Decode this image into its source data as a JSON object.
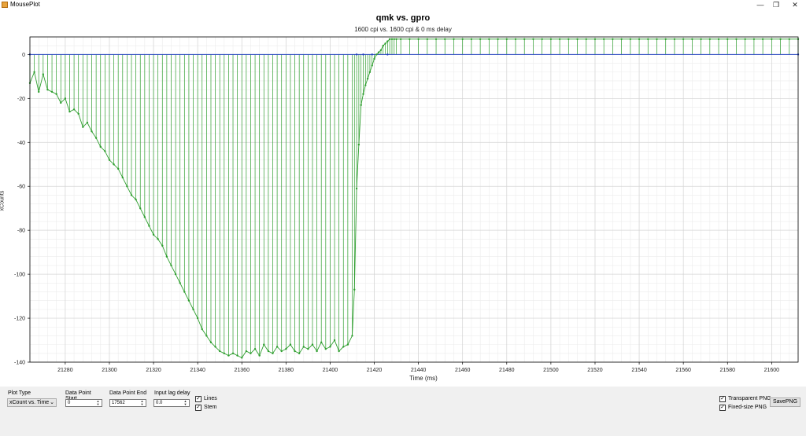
{
  "window": {
    "title": "MousePlot",
    "minimize": "—",
    "restore": "❐",
    "close": "✕"
  },
  "plot": {
    "title": "qmk vs. gpro",
    "subtitle": "1600 cpi vs. 1600 cpi & 0 ms delay"
  },
  "chart_data": {
    "type": "line",
    "title": "qmk vs. gpro",
    "subtitle": "1600 cpi vs. 1600 cpi & 0 ms delay",
    "xlabel": "Time (ms)",
    "ylabel": "xCounts",
    "xlim": [
      21264,
      21612
    ],
    "ylim": [
      -140,
      8
    ],
    "xticks": [
      21280,
      21300,
      21320,
      21340,
      21360,
      21380,
      21400,
      21420,
      21440,
      21460,
      21480,
      21500,
      21520,
      21540,
      21560,
      21580,
      21600
    ],
    "yticks": [
      0,
      -20,
      -40,
      -60,
      -80,
      -100,
      -120,
      -140
    ],
    "grid": true,
    "stem": true,
    "series": [
      {
        "color": "#2e9e2e",
        "x": [
          21264,
          21266,
          21268,
          21270,
          21272,
          21274,
          21276,
          21278,
          21280,
          21282,
          21284,
          21286,
          21288,
          21290,
          21292,
          21294,
          21296,
          21298,
          21300,
          21302,
          21304,
          21306,
          21308,
          21310,
          21312,
          21314,
          21316,
          21318,
          21320,
          21322,
          21324,
          21326,
          21328,
          21330,
          21332,
          21334,
          21336,
          21338,
          21340,
          21342,
          21344,
          21346,
          21348,
          21350,
          21352,
          21354,
          21356,
          21358,
          21360,
          21362,
          21364,
          21366,
          21368,
          21370,
          21372,
          21374,
          21376,
          21378,
          21380,
          21382,
          21384,
          21386,
          21388,
          21390,
          21392,
          21394,
          21396,
          21398,
          21400,
          21402,
          21404,
          21406,
          21408,
          21410,
          21411,
          21412,
          21413,
          21414,
          21415,
          21416,
          21417,
          21418,
          21419,
          21420,
          21421,
          21422,
          21423,
          21424,
          21425,
          21426,
          21427,
          21428,
          21429,
          21430,
          21432,
          21436,
          21440,
          21444,
          21448,
          21452,
          21456,
          21460,
          21464,
          21468,
          21472,
          21476,
          21480,
          21484,
          21488,
          21492,
          21496,
          21500,
          21504,
          21508,
          21512,
          21516,
          21520,
          21524,
          21528,
          21532,
          21536,
          21540,
          21544,
          21548,
          21552,
          21556,
          21560,
          21564,
          21568,
          21572,
          21576,
          21580,
          21584,
          21588,
          21592,
          21596,
          21600,
          21604,
          21608,
          21612
        ],
        "y": [
          -13,
          -8,
          -17,
          -9,
          -16,
          -17,
          -18,
          -22,
          -20,
          -26,
          -25,
          -27,
          -33,
          -31,
          -35,
          -38,
          -42,
          -44,
          -48,
          -50,
          -52,
          -56,
          -60,
          -64,
          -66,
          -70,
          -74,
          -78,
          -82,
          -84,
          -87,
          -92,
          -96,
          -100,
          -104,
          -108,
          -112,
          -116,
          -120,
          -125,
          -128,
          -131,
          -133,
          -135,
          -136,
          -137,
          -136,
          -137,
          -138,
          -135,
          -136,
          -134,
          -137,
          -132,
          -135,
          -136,
          -133,
          -135,
          -134,
          -132,
          -135,
          -136,
          -133,
          -134,
          -132,
          -135,
          -131,
          -134,
          -133,
          -130,
          -135,
          -133,
          -132,
          -128,
          -107,
          -61,
          -41,
          -23,
          -18,
          -14,
          -11,
          -8,
          -5,
          -2,
          0,
          1,
          2,
          4,
          5,
          6,
          7,
          7,
          7,
          7,
          7,
          7,
          7,
          7,
          7,
          7,
          7,
          7,
          7,
          7,
          7,
          7,
          7,
          7,
          7,
          7,
          7,
          7,
          7,
          7,
          7,
          7,
          7,
          7,
          7,
          7,
          7,
          7,
          7,
          7,
          7,
          7,
          7,
          7,
          7,
          7,
          7,
          7,
          7,
          7,
          7,
          7,
          7,
          7,
          7,
          7
        ]
      },
      {
        "color": "#1f3fbf",
        "x": [
          21264,
          21412,
          21415,
          21419,
          21426,
          21612
        ],
        "y": [
          0,
          0,
          0,
          0,
          0,
          0
        ]
      }
    ]
  },
  "controls": {
    "plot_type": {
      "label": "Plot Type",
      "value": "xCount vs. Time"
    },
    "data_point_start": {
      "label": "Data Point Start",
      "value": "0"
    },
    "data_point_end": {
      "label": "Data Point End",
      "value": "17562"
    },
    "input_lag_delay": {
      "label": "Input lag delay",
      "value": "0.0"
    },
    "lines": {
      "label": "Lines",
      "checked": "✓"
    },
    "stem": {
      "label": "Stem",
      "checked": "✓"
    },
    "transparent_png": {
      "label": "Transparent PNG",
      "checked": "✓"
    },
    "fixed_size_png": {
      "label": "Fixed-size PNG",
      "checked": "✓"
    },
    "save_png": {
      "label": "SavePNG"
    }
  }
}
